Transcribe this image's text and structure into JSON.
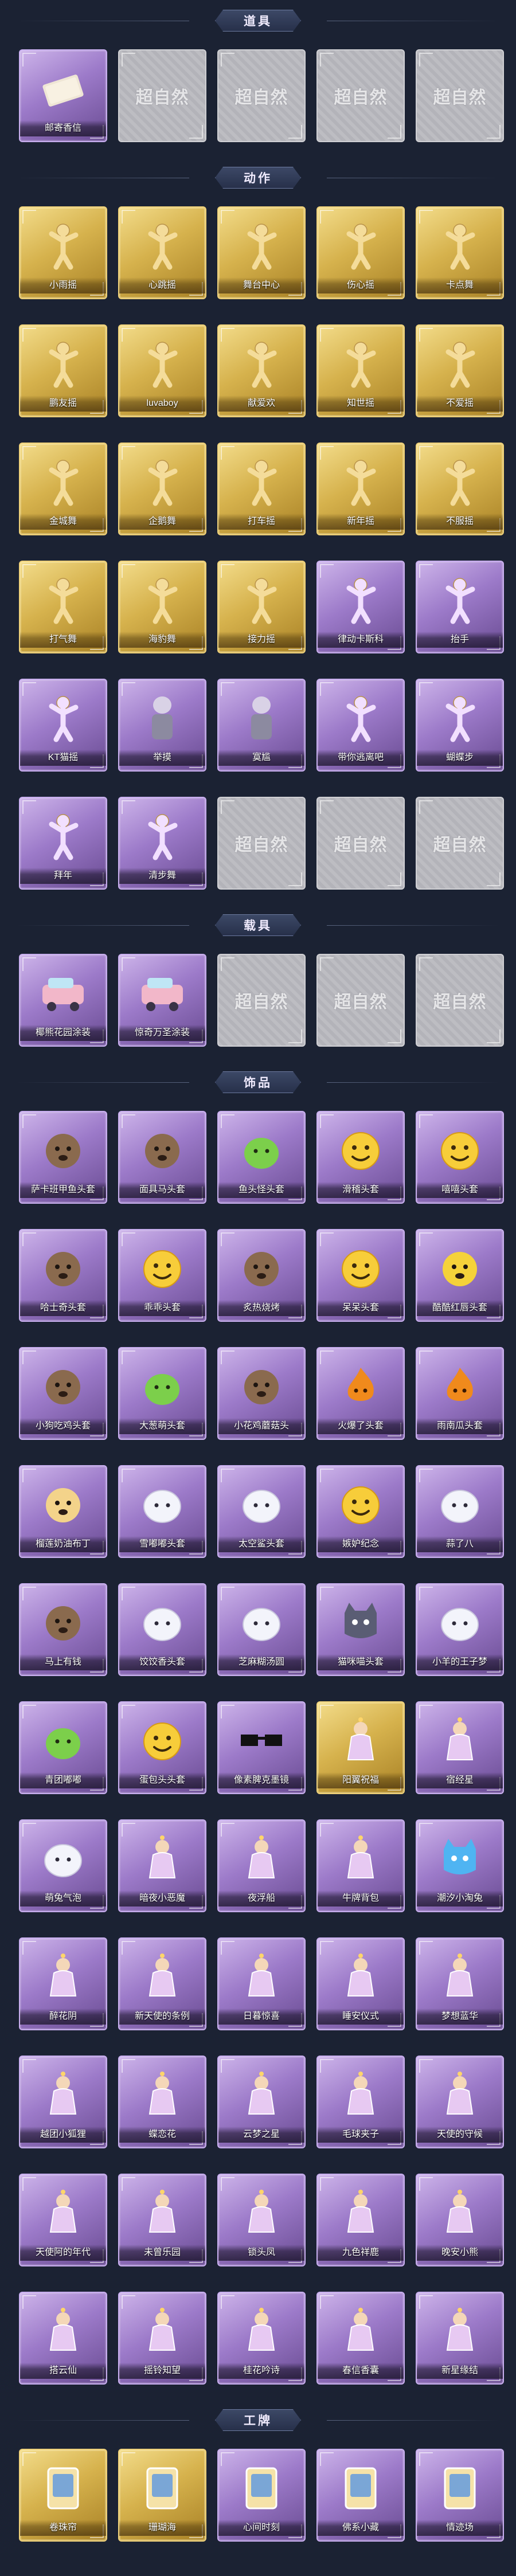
{
  "colors": {
    "background": "#1b2233",
    "gold": "#e0bd5a",
    "purple": "#9c7ac9",
    "grey": "#a9a9af"
  },
  "sections": [
    {
      "title": "道具",
      "items": [
        {
          "label": "邮寄香信",
          "rarity": "purple",
          "icon": "letter-bundle-icon"
        },
        {
          "label": "",
          "rarity": "blank",
          "watermark": "超自然",
          "icon": "placeholder-icon"
        },
        {
          "label": "",
          "rarity": "blank",
          "watermark": "超自然",
          "icon": "placeholder-icon"
        },
        {
          "label": "",
          "rarity": "blank",
          "watermark": "超自然",
          "icon": "placeholder-icon"
        },
        {
          "label": "",
          "rarity": "blank",
          "watermark": "超自然",
          "icon": "placeholder-icon"
        }
      ]
    },
    {
      "title": "动作",
      "items": [
        {
          "label": "小雨摇",
          "rarity": "gold",
          "icon": "dance-pose-icon"
        },
        {
          "label": "心跳摇",
          "rarity": "gold",
          "icon": "dance-pose-icon"
        },
        {
          "label": "舞台中心",
          "rarity": "gold",
          "icon": "dance-pose-icon"
        },
        {
          "label": "伤心摇",
          "rarity": "gold",
          "icon": "dance-pose-icon"
        },
        {
          "label": "卡点舞",
          "rarity": "gold",
          "icon": "dance-pose-icon"
        },
        {
          "label": "鹏友摇",
          "rarity": "gold",
          "icon": "dance-pose-icon"
        },
        {
          "label": "luvaboy",
          "rarity": "gold",
          "icon": "dance-pose-icon"
        },
        {
          "label": "献爱欢",
          "rarity": "gold",
          "icon": "dance-pose-icon"
        },
        {
          "label": "知世摇",
          "rarity": "gold",
          "icon": "dance-pose-icon"
        },
        {
          "label": "不爱摇",
          "rarity": "gold",
          "icon": "dance-pose-icon"
        },
        {
          "label": "金城舞",
          "rarity": "gold",
          "icon": "dance-pose-icon"
        },
        {
          "label": "企鹅舞",
          "rarity": "gold",
          "icon": "dance-pose-icon"
        },
        {
          "label": "打车摇",
          "rarity": "gold",
          "icon": "dance-pose-icon"
        },
        {
          "label": "新年摇",
          "rarity": "gold",
          "icon": "dance-pose-icon"
        },
        {
          "label": "不服摇",
          "rarity": "gold",
          "icon": "dance-pose-icon"
        },
        {
          "label": "打气舞",
          "rarity": "gold",
          "icon": "dance-pose-icon"
        },
        {
          "label": "海豹舞",
          "rarity": "gold",
          "icon": "dance-pose-icon"
        },
        {
          "label": "接力摇",
          "rarity": "gold",
          "icon": "dance-pose-icon"
        },
        {
          "label": "律动卡斯科",
          "rarity": "purple",
          "icon": "dance-pose-icon"
        },
        {
          "label": "抬手",
          "rarity": "purple",
          "icon": "hand-raise-icon"
        },
        {
          "label": "KT猫摇",
          "rarity": "purple",
          "icon": "dance-pose-icon"
        },
        {
          "label": "举摸",
          "rarity": "purple",
          "icon": "character-icon"
        },
        {
          "label": "寞尴",
          "rarity": "purple",
          "icon": "character-icon"
        },
        {
          "label": "带你逃离吧",
          "rarity": "purple",
          "icon": "dance-pose-icon"
        },
        {
          "label": "蝴蝶步",
          "rarity": "purple",
          "icon": "dance-pose-icon"
        },
        {
          "label": "拜年",
          "rarity": "purple",
          "icon": "dance-pose-icon"
        },
        {
          "label": "清步舞",
          "rarity": "purple",
          "icon": "dance-pose-icon"
        },
        {
          "label": "",
          "rarity": "blank",
          "watermark": "超自然",
          "icon": "placeholder-icon"
        },
        {
          "label": "",
          "rarity": "blank",
          "watermark": "超自然",
          "icon": "placeholder-icon"
        },
        {
          "label": "",
          "rarity": "blank",
          "watermark": "超自然",
          "icon": "placeholder-icon"
        }
      ]
    },
    {
      "title": "载具",
      "items": [
        {
          "label": "椰熊花园涂装",
          "rarity": "purple",
          "icon": "vehicle-icon"
        },
        {
          "label": "惊奇万圣涂装",
          "rarity": "purple",
          "icon": "vehicle-icon"
        },
        {
          "label": "",
          "rarity": "blank",
          "watermark": "超自然",
          "icon": "placeholder-icon"
        },
        {
          "label": "",
          "rarity": "blank",
          "watermark": "超自然",
          "icon": "placeholder-icon"
        },
        {
          "label": "",
          "rarity": "blank",
          "watermark": "超自然",
          "icon": "placeholder-icon"
        }
      ]
    },
    {
      "title": "饰品",
      "items": [
        {
          "label": "萨卡班甲鱼头套",
          "rarity": "purple",
          "icon": "fish-head-icon"
        },
        {
          "label": "面具马头套",
          "rarity": "purple",
          "icon": "horse-head-icon"
        },
        {
          "label": "鱼头怪头套",
          "rarity": "purple",
          "icon": "fish-monster-icon"
        },
        {
          "label": "滑稽头套",
          "rarity": "purple",
          "icon": "smiley-icon"
        },
        {
          "label": "嘻嘻头套",
          "rarity": "purple",
          "icon": "grin-icon"
        },
        {
          "label": "哈士奇头套",
          "rarity": "purple",
          "icon": "dog-head-icon"
        },
        {
          "label": "乖乖头套",
          "rarity": "purple",
          "icon": "smiley-icon"
        },
        {
          "label": "炙热烧烤",
          "rarity": "purple",
          "icon": "grill-icon"
        },
        {
          "label": "呆呆头套",
          "rarity": "purple",
          "icon": "smiley-icon"
        },
        {
          "label": "酷酷红唇头套",
          "rarity": "purple",
          "icon": "cool-face-icon"
        },
        {
          "label": "小狗吃鸡头套",
          "rarity": "purple",
          "icon": "creature-icon"
        },
        {
          "label": "大葱萌头套",
          "rarity": "purple",
          "icon": "scallion-icon"
        },
        {
          "label": "小花鸡蘑菇头",
          "rarity": "purple",
          "icon": "mushroom-icon"
        },
        {
          "label": "火爆了头套",
          "rarity": "purple",
          "icon": "fire-icon"
        },
        {
          "label": "雨南瓜头套",
          "rarity": "purple",
          "icon": "pumpkin-icon"
        },
        {
          "label": "榴莲奶油布丁",
          "rarity": "purple",
          "icon": "pudding-icon"
        },
        {
          "label": "雪嘟嘟头套",
          "rarity": "purple",
          "icon": "snowman-icon"
        },
        {
          "label": "太空鲨头套",
          "rarity": "purple",
          "icon": "ghost-icon"
        },
        {
          "label": "嫉妒纪念",
          "rarity": "purple",
          "icon": "cry-face-icon"
        },
        {
          "label": "蒜了八",
          "rarity": "purple",
          "icon": "garlic-icon"
        },
        {
          "label": "马上有钱",
          "rarity": "purple",
          "icon": "creature-icon"
        },
        {
          "label": "饺饺香头套",
          "rarity": "purple",
          "icon": "dumpling-icon"
        },
        {
          "label": "芝麻糊汤圆",
          "rarity": "purple",
          "icon": "dumpling-icon"
        },
        {
          "label": "猫咪喵头套",
          "rarity": "purple",
          "icon": "cat-head-icon"
        },
        {
          "label": "小羊的王子梦",
          "rarity": "purple",
          "icon": "sheep-icon"
        },
        {
          "label": "青团嘟嘟",
          "rarity": "purple",
          "icon": "green-bun-icon"
        },
        {
          "label": "蛋包头头套",
          "rarity": "purple",
          "icon": "egg-face-icon"
        },
        {
          "label": "像素脾克墨镜",
          "rarity": "purple",
          "icon": "sunglasses-icon"
        },
        {
          "label": "阳翼祝福",
          "rarity": "gold",
          "icon": "wing-icon"
        },
        {
          "label": "宿经星",
          "rarity": "purple",
          "icon": "halo-icon"
        },
        {
          "label": "萌兔气泡",
          "rarity": "purple",
          "icon": "bubble-icon"
        },
        {
          "label": "暗夜小恶魔",
          "rarity": "purple",
          "icon": "devil-icon"
        },
        {
          "label": "夜浮船",
          "rarity": "purple",
          "icon": "ship-icon"
        },
        {
          "label": "牛牌背包",
          "rarity": "purple",
          "icon": "backpack-icon"
        },
        {
          "label": "潮汐小淘兔",
          "rarity": "purple",
          "icon": "blue-cat-icon"
        },
        {
          "label": "醉花阴",
          "rarity": "purple",
          "icon": "lantern-icon"
        },
        {
          "label": "新天使的条例",
          "rarity": "purple",
          "icon": "angel-icon"
        },
        {
          "label": "日暮惊喜",
          "rarity": "purple",
          "icon": "bottle-icon"
        },
        {
          "label": "睡安仪式",
          "rarity": "purple",
          "icon": "doll-icon"
        },
        {
          "label": "梦想蓝华",
          "rarity": "purple",
          "icon": "doll-icon"
        },
        {
          "label": "越团小狐狸",
          "rarity": "purple",
          "icon": "fox-icon"
        },
        {
          "label": "蝶恋花",
          "rarity": "purple",
          "icon": "butterfly-icon"
        },
        {
          "label": "云梦之星",
          "rarity": "purple",
          "icon": "cloud-star-icon"
        },
        {
          "label": "毛球夹子",
          "rarity": "purple",
          "icon": "clip-icon"
        },
        {
          "label": "天使的守候",
          "rarity": "purple",
          "icon": "doll-icon"
        },
        {
          "label": "天使阿的年代",
          "rarity": "purple",
          "icon": "angel-icon"
        },
        {
          "label": "未曾乐园",
          "rarity": "purple",
          "icon": "doll-icon"
        },
        {
          "label": "锁头凤",
          "rarity": "purple",
          "icon": "phoenix-icon"
        },
        {
          "label": "九色祥鹿",
          "rarity": "purple",
          "icon": "deer-icon"
        },
        {
          "label": "晚安小熊",
          "rarity": "purple",
          "icon": "bear-icon"
        },
        {
          "label": "搭云仙",
          "rarity": "purple",
          "icon": "charm-icon"
        },
        {
          "label": "摇铃知望",
          "rarity": "purple",
          "icon": "charm-icon"
        },
        {
          "label": "桂花吟诗",
          "rarity": "purple",
          "icon": "charm-icon"
        },
        {
          "label": "春信香囊",
          "rarity": "purple",
          "icon": "charm-icon"
        },
        {
          "label": "新星缘结",
          "rarity": "purple",
          "icon": "charm-icon"
        }
      ]
    },
    {
      "title": "工牌",
      "items": [
        {
          "label": "卷珠帘",
          "rarity": "gold",
          "icon": "badge-card-icon"
        },
        {
          "label": "珊瑚海",
          "rarity": "gold",
          "icon": "badge-card-icon"
        },
        {
          "label": "心间时刻",
          "rarity": "purple",
          "icon": "badge-card-icon"
        },
        {
          "label": "佛系小藏",
          "rarity": "purple",
          "icon": "badge-card-icon"
        },
        {
          "label": "情迹场",
          "rarity": "purple",
          "icon": "badge-card-icon"
        }
      ]
    }
  ]
}
